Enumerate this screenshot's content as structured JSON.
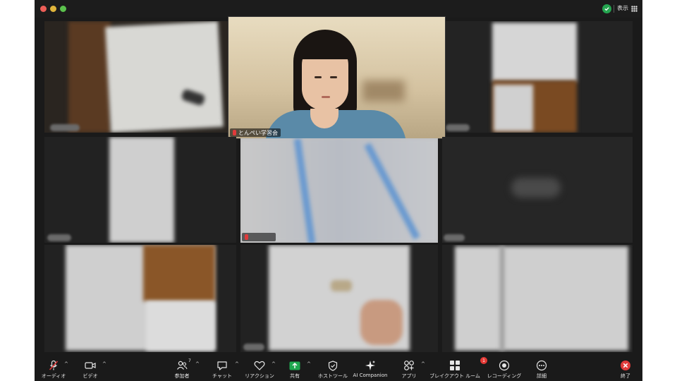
{
  "window": {
    "view_label": "表示",
    "security_color": "#25a550"
  },
  "participants": {
    "host_name": "とんぺい学習会"
  },
  "toolbar": {
    "audio_label": "オーディオ",
    "video_label": "ビデオ",
    "participants_label": "参加者",
    "participants_count": "7",
    "chat_label": "チャット",
    "reactions_label": "リアクション",
    "share_label": "共有",
    "host_tools_label": "ホストツール",
    "ai_label": "AI Companion",
    "apps_label": "アプリ",
    "breakout_label": "ブレイクアウト ルーム",
    "breakout_badge": "1",
    "record_label": "レコーディング",
    "more_label": "詳細",
    "end_label": "終了"
  },
  "icons": [
    "mic-muted-icon",
    "video-icon",
    "participants-icon",
    "chat-icon",
    "reaction-heart-icon",
    "share-screen-icon",
    "host-shield-icon",
    "ai-sparkle-icon",
    "apps-icon",
    "breakout-grid-icon",
    "record-icon",
    "more-dots-icon",
    "end-icon"
  ],
  "colors": {
    "share_green": "#1fa84f",
    "end_red": "#e03a3a",
    "badge_red": "#e53935"
  }
}
